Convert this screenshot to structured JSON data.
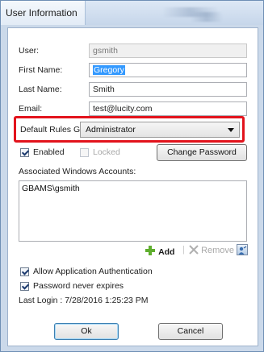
{
  "window": {
    "title": "User Information"
  },
  "form": {
    "user_label": "User:",
    "user_value": "gsmith",
    "first_name_label": "First Name:",
    "first_name_value": "Gregory",
    "last_name_label": "Last Name:",
    "last_name_value": "Smith",
    "email_label": "Email:",
    "email_value": "test@lucity.com",
    "default_rules_group_label": "Default Rules Group:",
    "default_rules_group_value": "Administrator"
  },
  "status": {
    "enabled_label": "Enabled",
    "enabled_checked": true,
    "locked_label": "Locked",
    "locked_checked": false,
    "change_password_label": "Change Password"
  },
  "windows_accounts": {
    "label": "Associated Windows Accounts:",
    "items": [
      "GBAMS\\gsmith"
    ],
    "add_label": "Add",
    "remove_label": "Remove"
  },
  "options": {
    "allow_app_auth_label": "Allow Application Authentication",
    "allow_app_auth_checked": true,
    "password_never_expires_label": "Password never expires",
    "password_never_expires_checked": true,
    "last_login_text": "Last Login : 7/28/2016 1:25:23 PM"
  },
  "footer": {
    "ok_label": "Ok",
    "cancel_label": "Cancel"
  },
  "colors": {
    "highlight": "#e2131c",
    "selection": "#3399ff",
    "add_icon": "#5fae2e"
  }
}
